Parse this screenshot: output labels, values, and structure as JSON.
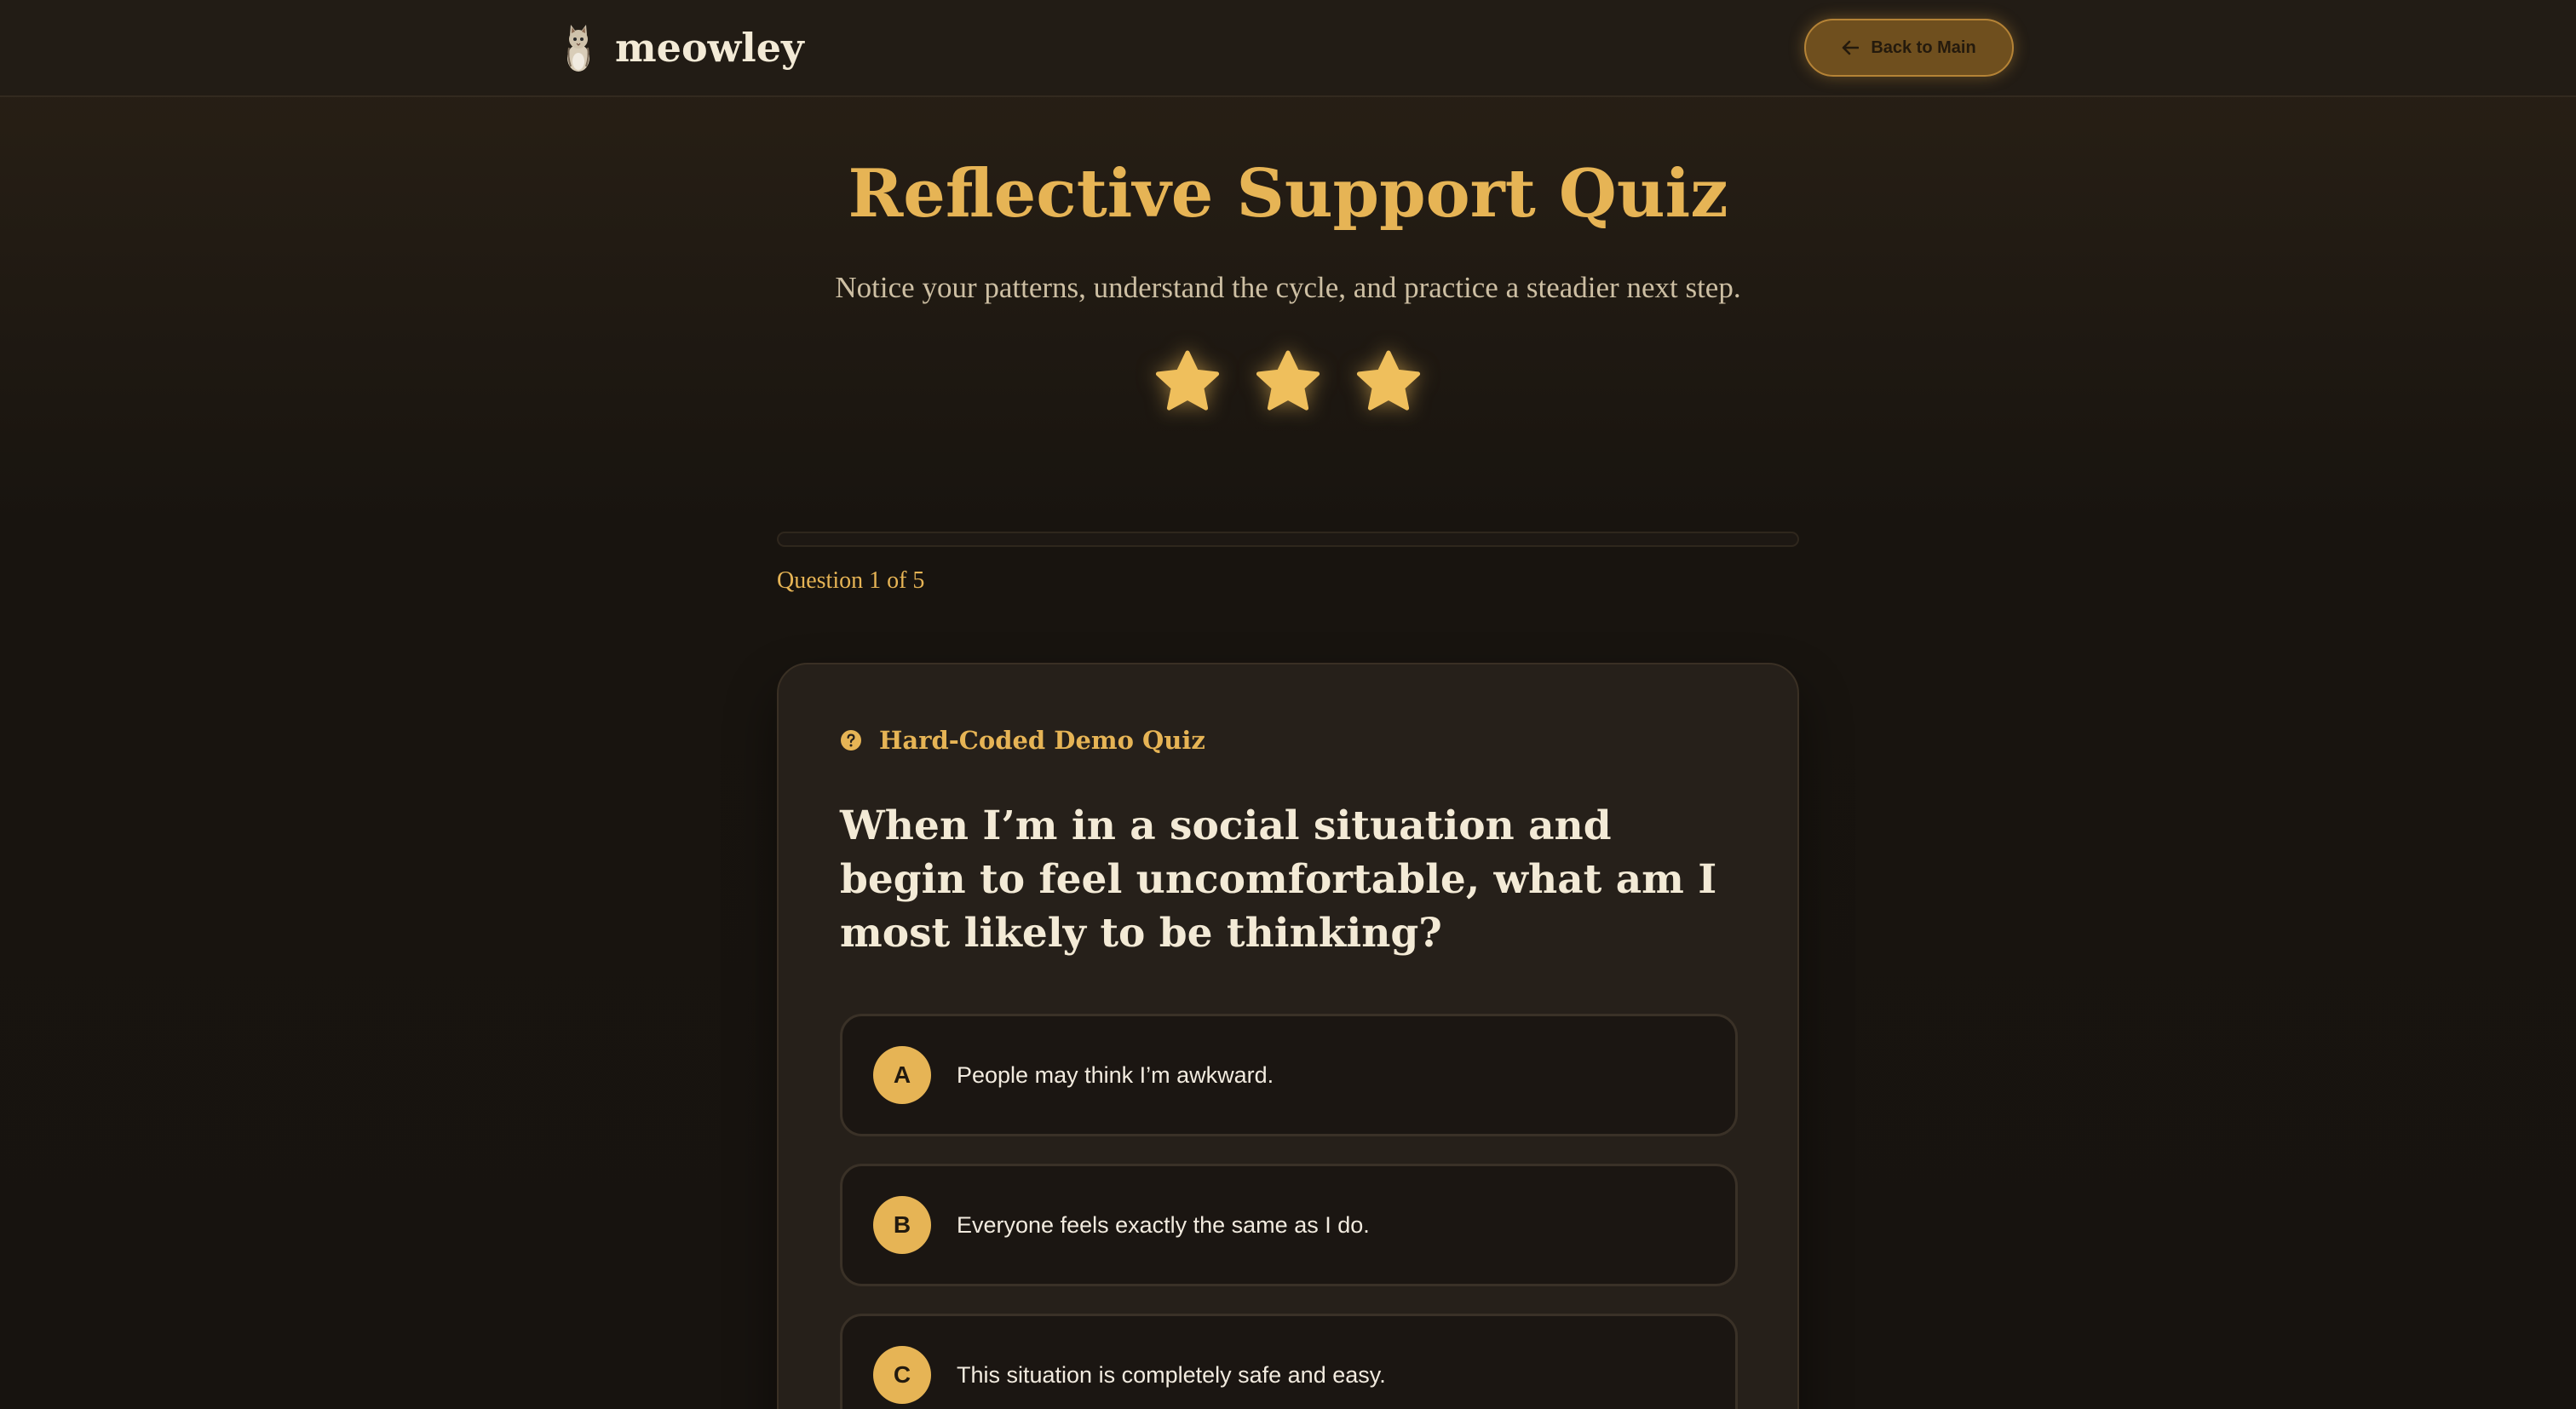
{
  "header": {
    "brand_name": "meowley",
    "back_label": "Back to Main"
  },
  "hero": {
    "title": "Reflective Support Quiz",
    "subtitle": "Notice your patterns, understand the cycle, and practice a steadier next step.",
    "stars_filled": 3
  },
  "progress": {
    "label": "Question 1 of 5",
    "fraction": 0
  },
  "quiz": {
    "tag_label": "Hard-Coded Demo Quiz",
    "question": "When I’m in a social situation and begin to feel uncomfortable, what am I most likely to be thinking?",
    "options": [
      {
        "letter": "A",
        "text": "People may think I’m awkward."
      },
      {
        "letter": "B",
        "text": "Everyone feels exactly the same as I do."
      },
      {
        "letter": "C",
        "text": "This situation is completely safe and easy."
      }
    ]
  },
  "colors": {
    "accent": "#e6b455",
    "background": "#17130f",
    "card": "#26201a",
    "text": "#f3ead6"
  },
  "icons": {
    "logo": "cat-logo-icon",
    "back": "arrow-left-icon",
    "star": "star-icon",
    "tag": "question-circle-icon"
  }
}
